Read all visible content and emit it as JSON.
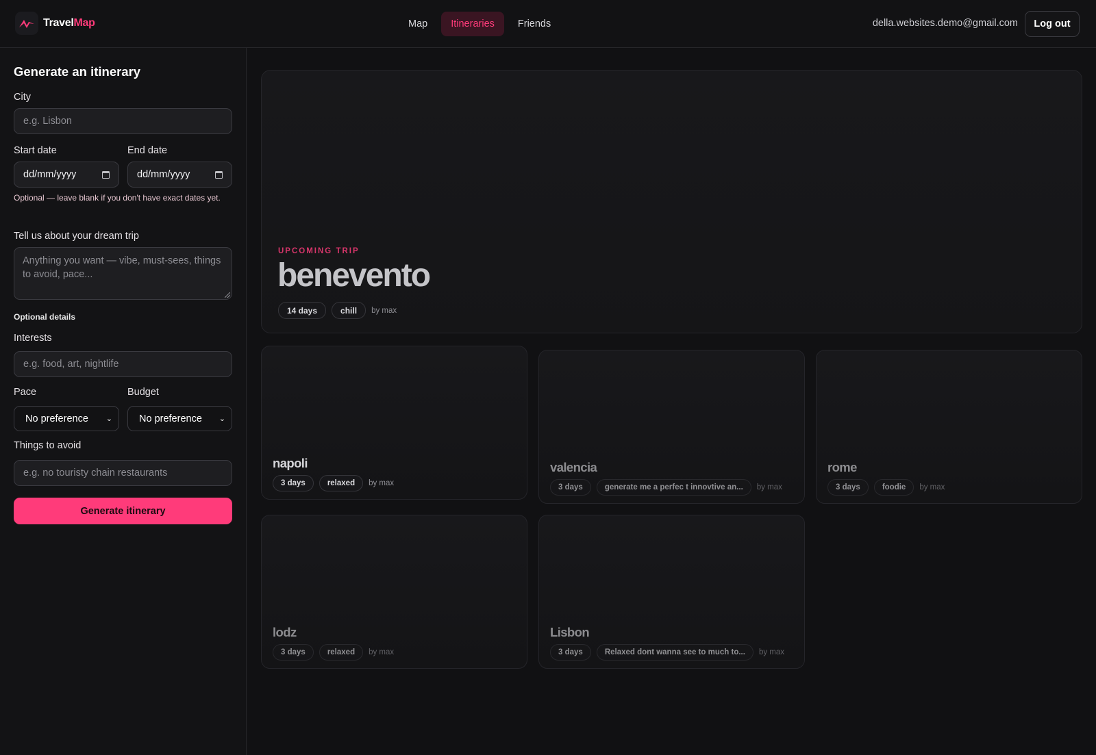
{
  "brand": {
    "name_part1": "Travel",
    "name_part2": "Map",
    "accent": "#ff3b7a"
  },
  "nav": {
    "items": [
      {
        "label": "Map",
        "active": false
      },
      {
        "label": "Itineraries",
        "active": true
      },
      {
        "label": "Friends",
        "active": false
      }
    ]
  },
  "user": {
    "email": "della.websites.demo@gmail.com",
    "logout_label": "Log out"
  },
  "form": {
    "title": "Generate an itinerary",
    "city_label": "City",
    "city_placeholder": "e.g. Lisbon",
    "start_label": "Start date",
    "start_value": "dd/mm/yyyy",
    "end_label": "End date",
    "end_value": "dd/mm/yyyy",
    "dates_hint": "Optional — leave blank if you don't have exact dates yet.",
    "dream_label": "Tell us about your dream trip",
    "dream_placeholder": "Anything you want — vibe, must-sees, things to avoid, pace...",
    "optional_details": "Optional details",
    "interests_label": "Interests",
    "interests_placeholder": "e.g. food, art, nightlife",
    "pace_label": "Pace",
    "pace_value": "No preference",
    "budget_label": "Budget",
    "budget_value": "No preference",
    "avoid_label": "Things to avoid",
    "avoid_placeholder": "e.g. no touristy chain restaurants",
    "submit_label": "Generate itinerary"
  },
  "hero": {
    "kicker": "UPCOMING TRIP",
    "city": "benevento",
    "days": "14 days",
    "vibe": "chill",
    "byline": "by max"
  },
  "itineraries": [
    {
      "city": "napoli",
      "days": "3 days",
      "vibe": "relaxed",
      "byline": "by max"
    },
    {
      "city": "valencia",
      "days": "3 days",
      "vibe": "generate me a perfec t innovtive an...",
      "byline": "by max"
    },
    {
      "city": "rome",
      "days": "3 days",
      "vibe": "foodie",
      "byline": "by max"
    },
    {
      "city": "lodz",
      "days": "3 days",
      "vibe": "relaxed",
      "byline": "by max"
    },
    {
      "city": "Lisbon",
      "days": "3 days",
      "vibe": "Relaxed dont wanna see to much to...",
      "byline": "by max"
    }
  ]
}
